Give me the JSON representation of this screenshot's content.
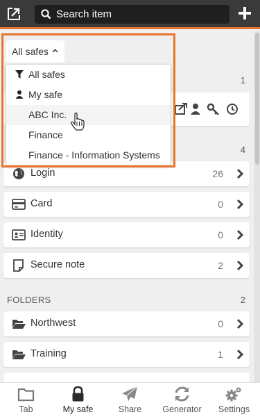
{
  "header": {
    "search_placeholder": "Search item",
    "logo_icon": "exit-arrow-icon",
    "add_icon": "plus-icon",
    "accent_color": "#e8732c"
  },
  "safe_selector": {
    "label": "All safes",
    "options": [
      {
        "label": "All safes",
        "icon": "filter-icon"
      },
      {
        "label": "My safe",
        "icon": "user-icon"
      },
      {
        "label": "ABC Inc.",
        "icon": ""
      },
      {
        "label": "Finance",
        "icon": ""
      },
      {
        "label": "Finance - Information Systems",
        "icon": ""
      }
    ],
    "hovered_index": 2
  },
  "favorites_section": {
    "count": "1"
  },
  "types_section": {
    "count": "4",
    "items": [
      {
        "label": "Login",
        "count": "26",
        "icon": "globe-icon"
      },
      {
        "label": "Card",
        "count": "0",
        "icon": "credit-card-icon"
      },
      {
        "label": "Identity",
        "count": "0",
        "icon": "id-card-icon"
      },
      {
        "label": "Secure note",
        "count": "2",
        "icon": "note-icon"
      }
    ]
  },
  "folders_section": {
    "title": "FOLDERS",
    "count": "2",
    "items": [
      {
        "label": "Northwest",
        "count": "0",
        "icon": "folder-open-icon"
      },
      {
        "label": "Training",
        "count": "1",
        "icon": "folder-open-icon"
      }
    ]
  },
  "bottom_nav": [
    {
      "label": "Tab",
      "icon": "folder-icon"
    },
    {
      "label": "My safe",
      "icon": "lock-icon",
      "active": true
    },
    {
      "label": "Share",
      "icon": "paper-plane-icon"
    },
    {
      "label": "Generator",
      "icon": "refresh-icon"
    },
    {
      "label": "Settings",
      "icon": "gears-icon"
    }
  ]
}
